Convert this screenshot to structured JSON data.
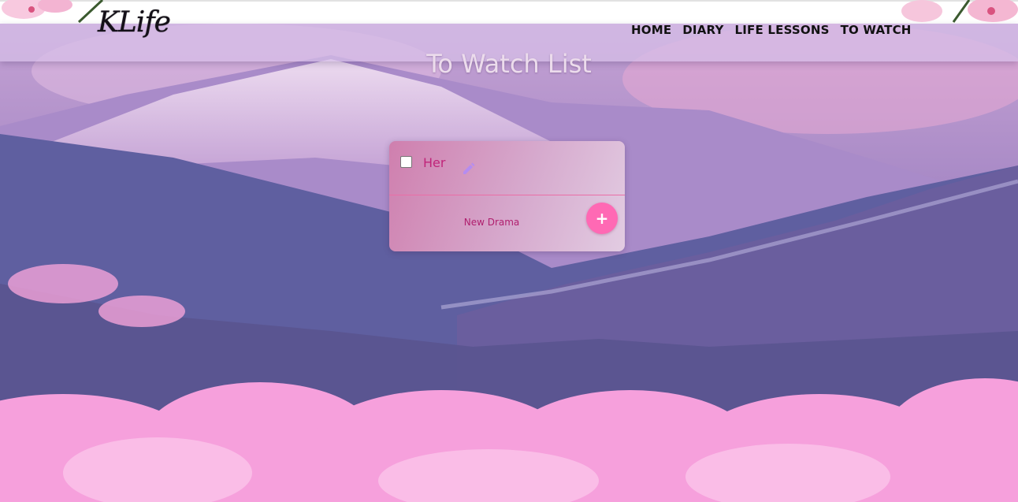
{
  "brand": {
    "logo_text": "KLife"
  },
  "nav": {
    "items": [
      "HOME",
      "DIARY",
      "LIFE LESSONS",
      "TO WATCH"
    ]
  },
  "page": {
    "title": "To Watch List"
  },
  "watch_list": {
    "items": [
      {
        "text": "Her",
        "checked": false
      }
    ],
    "new_item": {
      "placeholder": "New Drama",
      "value": ""
    },
    "add_label": "+"
  },
  "colors": {
    "accent": "#ff69b4",
    "item_text": "#c0257a",
    "divider": "#ea6ea6",
    "edit_icon": "#b58cf0"
  },
  "icons": {
    "edit": "pencil-icon",
    "add": "plus-icon"
  }
}
